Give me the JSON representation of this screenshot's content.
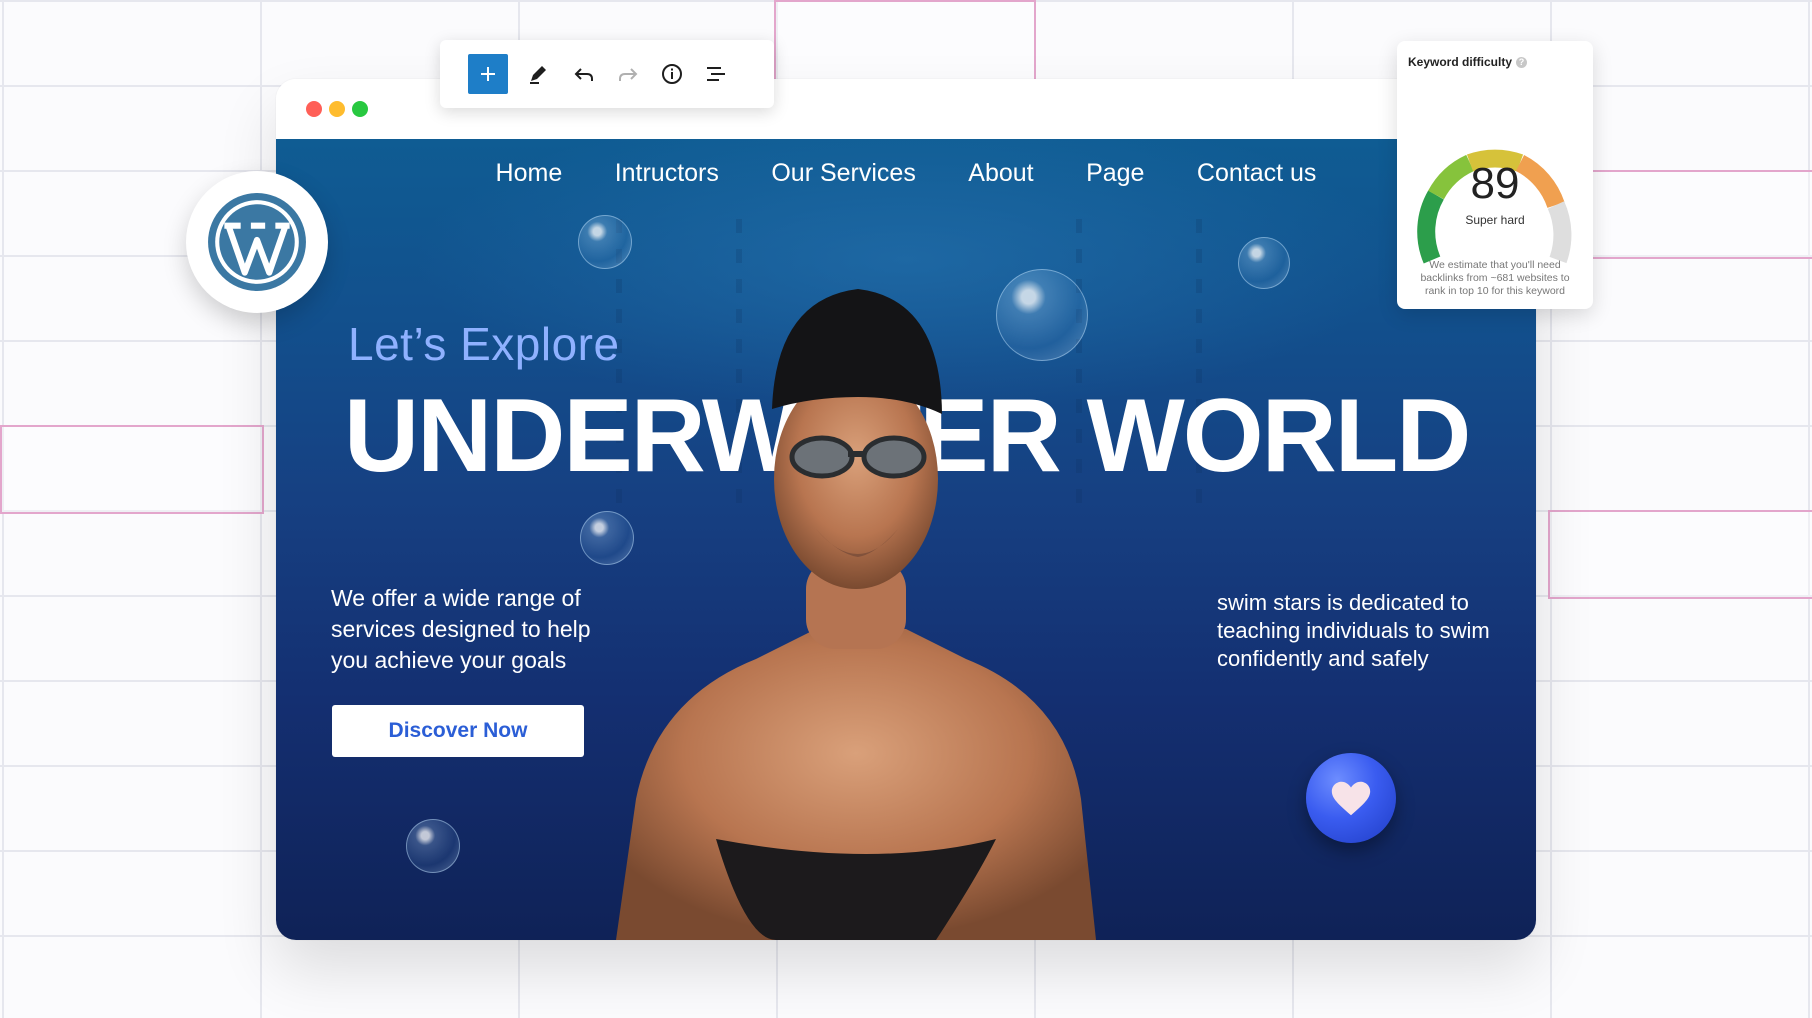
{
  "toolbar": {
    "icons": [
      "plus-icon",
      "pencil-icon",
      "undo-icon",
      "redo-icon",
      "info-icon",
      "list-view-icon"
    ],
    "accent": "#1e7ec8"
  },
  "window": {
    "traffic_lights": [
      "#ff5f57",
      "#febc2e",
      "#28c840"
    ]
  },
  "nav": {
    "items": [
      "Home",
      "Intructors",
      "Our Services",
      "About",
      "Page",
      "Contact us"
    ]
  },
  "hero": {
    "eyebrow": "Let’s Explore",
    "headline": "UNDERWATER WORLD",
    "left_text": "We offer a wide range of services designed to help you achieve your goals",
    "cta": "Discover Now",
    "right_text": "swim stars is dedicated to teaching individuals to swim confidently and safely"
  },
  "keyword_difficulty": {
    "title": "Keyword difficulty",
    "score": "89",
    "level": "Super hard",
    "note": "We estimate that you'll need backlinks from ~681 websites to rank in top 10 for this keyword",
    "value_fraction": 0.89
  }
}
